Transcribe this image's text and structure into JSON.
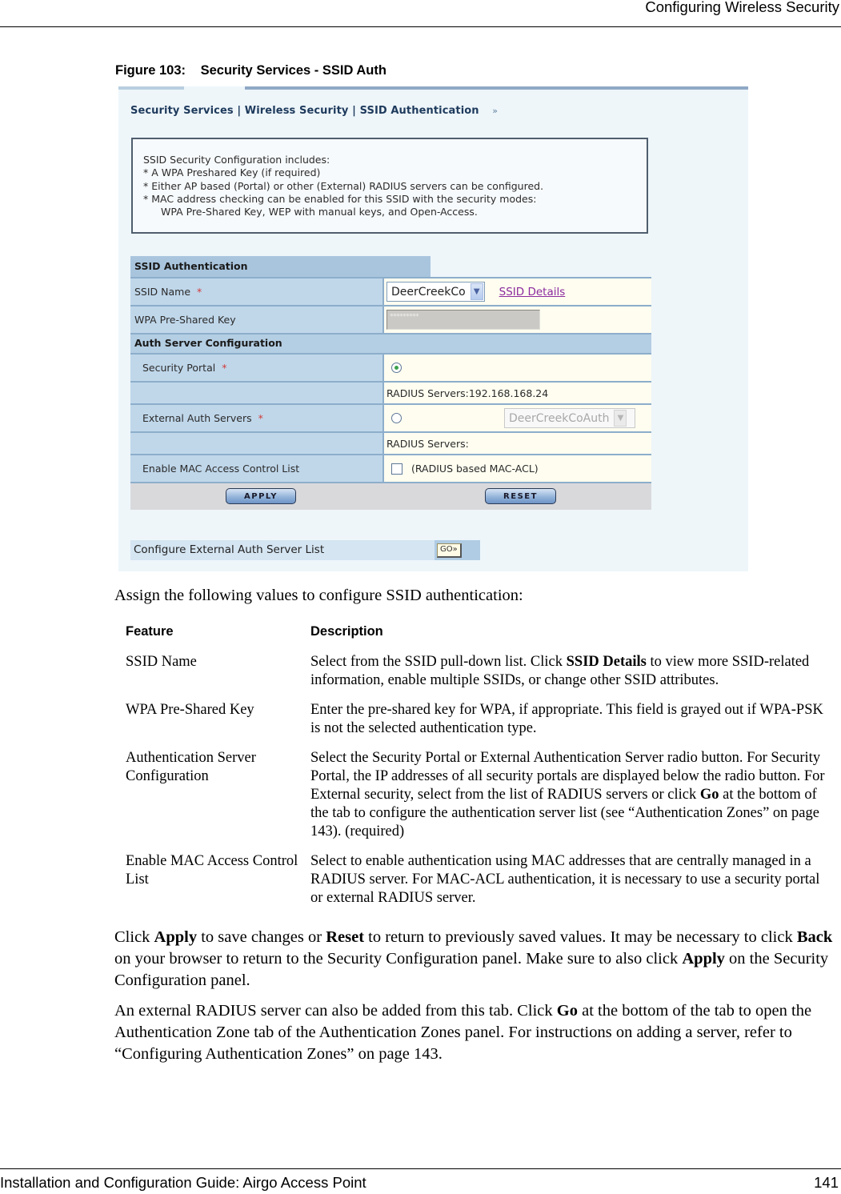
{
  "page": {
    "running_header": "Configuring Wireless Security",
    "footer_title": "Installation and Configuration Guide: Airgo Access Point",
    "page_number": "141"
  },
  "figure": {
    "number": "Figure 103:",
    "title": "Security Services - SSID Auth"
  },
  "ui": {
    "breadcrumb": "Security Services | Wireless Security | SSID Authentication",
    "breadcrumb_icon": "double-chevron-right-icon",
    "breadcrumb_chevron": "»",
    "info_lines": [
      "SSID Security Configuration includes:",
      "* A WPA Preshared Key (if required)",
      "* Either AP based (Portal) or other (External) RADIUS servers can be configured.",
      "* MAC address checking can be enabled for this SSID with the security modes:",
      "WPA Pre-Shared Key, WEP with manual keys, and Open-Access."
    ],
    "section_ssid_auth": "SSID Authentication",
    "ssid_name_label": "SSID Name",
    "required_marker": "*",
    "ssid_select_value": "DeerCreekCo",
    "select_arrow": "▼",
    "ssid_details_link": "SSID Details",
    "wpa_psk_label": "WPA Pre-Shared Key",
    "wpa_psk_value": "*********",
    "section_auth_server": "Auth Server Configuration",
    "security_portal_label": "Security Portal",
    "security_portal_selected": true,
    "portal_radius_servers": "RADIUS Servers:192.168.168.24",
    "external_auth_label": "External Auth Servers",
    "external_auth_selected": false,
    "external_select_value": "DeerCreekCoAuth",
    "external_radius_servers": "RADIUS Servers:",
    "mac_acl_label": "Enable MAC Access Control List",
    "mac_acl_checked": false,
    "mac_acl_hint": "(RADIUS based MAC-ACL)",
    "apply_button": "APPLY",
    "reset_button": "RESET",
    "ext_list_label": "Configure External Auth Server List",
    "go_button": "GO»"
  },
  "body": {
    "intro": "Assign the following values to configure SSID authentication:",
    "table": {
      "headers": [
        "Feature",
        "Description"
      ],
      "rows": [
        {
          "feature": "SSID Name",
          "description_parts": [
            "Select from the SSID pull-down list. Click ",
            "SSID Details",
            " to view more SSID-related information, enable multiple SSIDs, or change other SSID attributes."
          ]
        },
        {
          "feature": "WPA Pre-Shared Key",
          "description_parts": [
            "Enter the pre-shared key for WPA, if appropriate. This field is grayed out if WPA-PSK is not the selected authentication type."
          ]
        },
        {
          "feature": "Authentication Server Configuration",
          "description_parts": [
            "Select the Security Portal or External Authentication Server radio button. For Security Portal, the IP addresses of all security portals are displayed below the radio button. For External security, select from the list of RADIUS servers or click ",
            "Go",
            " at the bottom of the tab to configure the authentication server list (see “Authentication Zones” on page 143). (required)"
          ]
        },
        {
          "feature": "Enable MAC Access Control List",
          "description_parts": [
            "Select to enable authentication using MAC addresses that are centrally managed in a RADIUS server. For MAC-ACL authentication, it is necessary to use a security portal or external RADIUS server."
          ]
        }
      ]
    },
    "paragraph1_parts": [
      "Click ",
      "Apply",
      " to save changes or ",
      "Reset",
      " to return to previously saved values. It may be necessary to click ",
      "Back",
      " on your browser to return to the Security Configuration panel. Make sure to also click ",
      "Apply",
      " on the Security Configuration panel."
    ],
    "paragraph2_parts": [
      "An external RADIUS server can also be added from this tab. Click ",
      "Go",
      " at the bottom of the tab to open the Authentication Zone tab of the Authentication Zones panel. For instructions on adding a server, refer to “Configuring Authentication Zones” on page 143."
    ]
  }
}
